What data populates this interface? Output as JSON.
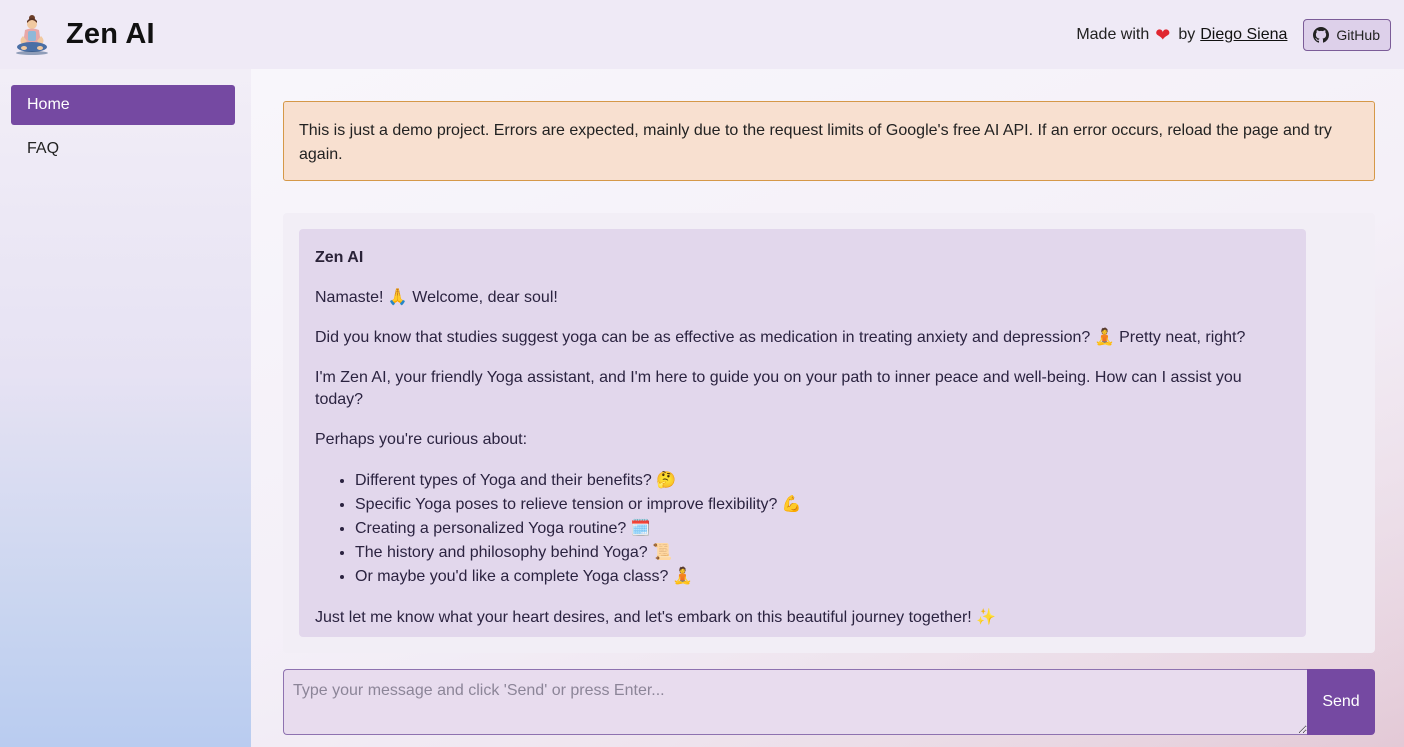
{
  "header": {
    "title": "Zen AI",
    "made_with": "Made with",
    "heart": "❤",
    "by": "by",
    "author": "Diego Siena",
    "github_label": "GitHub"
  },
  "sidebar": {
    "items": [
      {
        "label": "Home",
        "active": true
      },
      {
        "label": "FAQ",
        "active": false
      }
    ]
  },
  "alert": {
    "text": "This is just a demo project. Errors are expected, mainly due to the request limits of Google's free AI API. If an error occurs, reload the page and try again."
  },
  "chat": {
    "sender": "Zen AI",
    "greeting": "Namaste! 🙏 Welcome, dear soul!",
    "fact": "Did you know that studies suggest yoga can be as effective as medication in treating anxiety and depression? 🧘 Pretty neat, right?",
    "intro": "I'm Zen AI, your friendly Yoga assistant, and I'm here to guide you on your path to inner peace and well-being. How can I assist you today?",
    "prompt": "Perhaps you're curious about:",
    "suggestions": [
      "Different types of Yoga and their benefits? 🤔",
      "Specific Yoga poses to relieve tension or improve flexibility? 💪",
      "Creating a personalized Yoga routine? 🗓️",
      "The history and philosophy behind Yoga? 📜",
      "Or maybe you'd like a complete Yoga class? 🧘"
    ],
    "closing": "Just let me know what your heart desires, and let's embark on this beautiful journey together! ✨"
  },
  "composer": {
    "placeholder": "Type your message and click 'Send' or press Enter...",
    "value": "",
    "send_label": "Send"
  },
  "colors": {
    "accent": "#7549a2",
    "alert_bg": "#f8e0d0",
    "alert_border": "#d59848",
    "bubble_bg": "#e2d7ec"
  },
  "icons": {
    "logo": "meditating-figure-icon",
    "heart": "heart-icon",
    "github": "github-icon"
  }
}
